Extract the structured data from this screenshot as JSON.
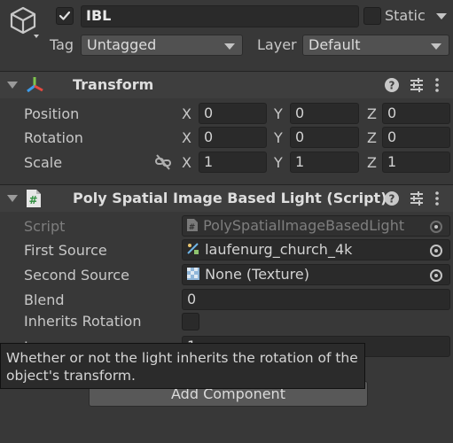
{
  "header": {
    "object_name": "IBL",
    "static_label": "Static",
    "tag_label": "Tag",
    "tag_value": "Untagged",
    "layer_label": "Layer",
    "layer_value": "Default"
  },
  "transform": {
    "title": "Transform",
    "rows": [
      {
        "label": "Position",
        "x": "0",
        "y": "0",
        "z": "0"
      },
      {
        "label": "Rotation",
        "x": "0",
        "y": "0",
        "z": "0"
      },
      {
        "label": "Scale",
        "x": "1",
        "y": "1",
        "z": "1"
      }
    ],
    "axis": {
      "x": "X",
      "y": "Y",
      "z": "Z"
    }
  },
  "script_component": {
    "title": "Poly Spatial Image Based Light (Script)",
    "script_label": "Script",
    "script_value": "PolySpatialImageBasedLight",
    "first_source_label": "First Source",
    "first_source_value": "laufenurg_church_4k",
    "second_source_label": "Second Source",
    "second_source_value": "None (Texture)",
    "blend_label": "Blend",
    "blend_value": "0",
    "inherits_rotation_label": "Inherits Rotation",
    "partial_label": "I",
    "partial_value": "1"
  },
  "add_component_label": "Add Component",
  "tooltip_text": "Whether or not the light inherits the rotation of the object's transform.",
  "colors": {
    "background": "#383838",
    "header_bg": "#3e3e3e",
    "field_bg": "#2a2a2a",
    "transform_icon_red": "#e5483f",
    "transform_icon_green": "#7fc44d",
    "transform_icon_blue": "#3d9be9"
  },
  "icons": [
    "cube-icon",
    "checkmark-icon",
    "transform-axes-icon",
    "script-hash-icon",
    "help-icon",
    "presets-icon",
    "more-icon",
    "constrain-proportions-icon",
    "texture-icon",
    "object-picker-icon"
  ]
}
